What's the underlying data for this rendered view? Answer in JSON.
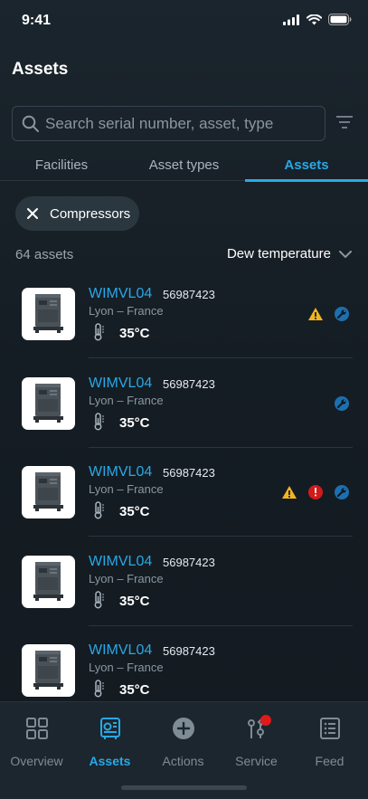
{
  "status_bar": {
    "time": "9:41"
  },
  "page": {
    "title": "Assets"
  },
  "search": {
    "placeholder": "Search serial number, asset, type",
    "value": ""
  },
  "tabs": [
    {
      "label": "Facilities",
      "active": false
    },
    {
      "label": "Asset types",
      "active": false
    },
    {
      "label": "Assets",
      "active": true
    }
  ],
  "filter_chip": {
    "label": "Compressors"
  },
  "list_header": {
    "count": "64 assets",
    "sort_label": "Dew temperature"
  },
  "assets": [
    {
      "name": "WIMVL04",
      "serial": "56987423",
      "location": "Lyon – France",
      "temperature": "35°C",
      "badges": [
        "warning",
        "service"
      ]
    },
    {
      "name": "WIMVL04",
      "serial": "56987423",
      "location": "Lyon – France",
      "temperature": "35°C",
      "badges": [
        "service"
      ]
    },
    {
      "name": "WIMVL04",
      "serial": "56987423",
      "location": "Lyon – France",
      "temperature": "35°C",
      "badges": [
        "warning",
        "error",
        "service"
      ]
    },
    {
      "name": "WIMVL04",
      "serial": "56987423",
      "location": "Lyon – France",
      "temperature": "35°C",
      "badges": []
    },
    {
      "name": "WIMVL04",
      "serial": "56987423",
      "location": "Lyon – France",
      "temperature": "35°C",
      "badges": []
    }
  ],
  "bottom_nav": [
    {
      "label": "Overview",
      "icon": "grid-icon",
      "active": false
    },
    {
      "label": "Assets",
      "icon": "compressor-icon",
      "active": true
    },
    {
      "label": "Actions",
      "icon": "plus-circle-icon",
      "active": false
    },
    {
      "label": "Service",
      "icon": "service-icon",
      "active": false,
      "notification_dot": true
    },
    {
      "label": "Feed",
      "icon": "list-icon",
      "active": false
    }
  ],
  "colors": {
    "accent": "#29a8e6",
    "warning": "#f2b51f",
    "error": "#d01b1b",
    "service": "#1e6fae",
    "background": "#151d24"
  }
}
